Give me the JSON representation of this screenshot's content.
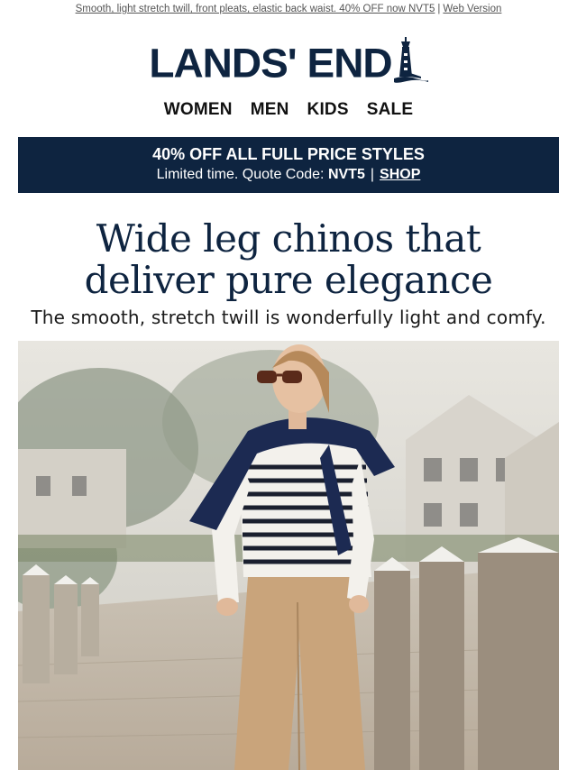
{
  "preheader": {
    "text": "Smooth, light stretch twill, front pleats, elastic back waist. 40% OFF now NVT5",
    "separator": "|",
    "web_version": "Web Version"
  },
  "brand": {
    "logo_text": "LANDS' END"
  },
  "nav": {
    "items": [
      {
        "label": "WOMEN"
      },
      {
        "label": "MEN"
      },
      {
        "label": "KIDS"
      },
      {
        "label": "SALE"
      }
    ]
  },
  "promo": {
    "headline": "40% OFF ALL FULL PRICE STYLES",
    "sub_prefix": "Limited time. Quote Code:",
    "code": "NVT5",
    "separator": "|",
    "cta": "SHOP",
    "bg_color": "#0e2440"
  },
  "hero": {
    "title_line1": "Wide leg chinos that",
    "title_line2": "deliver pure elegance",
    "subtitle": "The smooth, stretch twill is wonderfully light and comfy."
  },
  "colors": {
    "navy": "#0e2440",
    "khaki": "#c9a47b"
  }
}
